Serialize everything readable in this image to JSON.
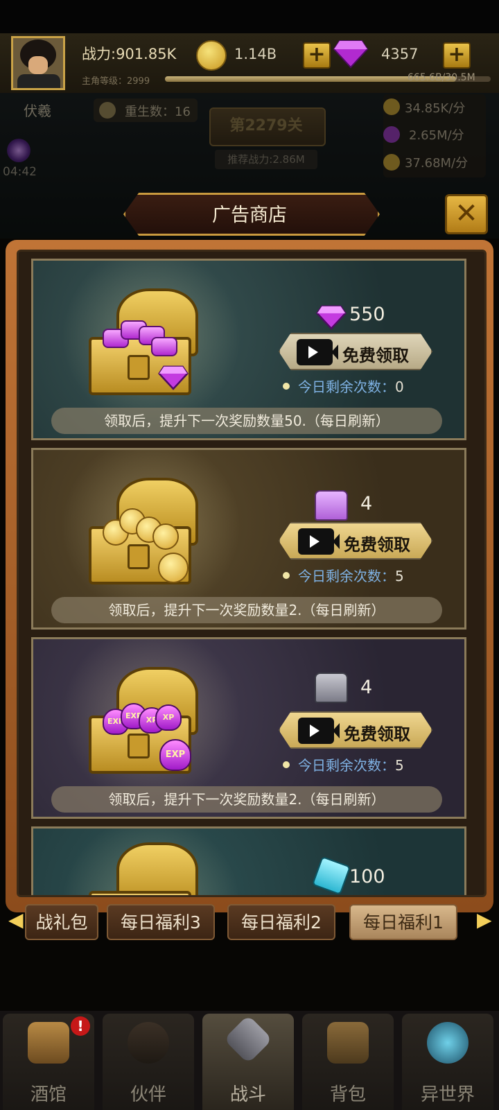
{
  "header": {
    "power": "战力:901.85K",
    "gold": "1.14B",
    "gems": "4357",
    "level_label": "主角等级：2999",
    "exp": "665.6B/30.5M",
    "level_progress": 0.9
  },
  "scene": {
    "hero_name": "伏羲",
    "rebirth": "重生数：16",
    "stage": "第2279关",
    "recommended_power": "推荐战力:2.86M",
    "timer": "04:42",
    "rates": [
      "34.85K/分",
      "2.65M/分",
      "37.68M/分"
    ]
  },
  "shop": {
    "title": "广告商店",
    "close_icon": "close-x-icon",
    "cards": [
      {
        "reward_icon": "gem-icon",
        "amount": "550",
        "button": "免费领取",
        "remaining_label": "今日剩余次数：",
        "remaining_value": "0",
        "note": "领取后，提升下一次奖励数量50.（每日刷新）",
        "bg": "#233637"
      },
      {
        "reward_icon": "gold-chest-icon",
        "amount": "4",
        "button": "免费领取",
        "remaining_label": "今日剩余次数：",
        "remaining_value": "5",
        "note": "领取后，提升下一次奖励数量2.（每日刷新）",
        "bg": "#3d311d"
      },
      {
        "reward_icon": "exp-chest-icon",
        "amount": "4",
        "button": "免费领取",
        "remaining_label": "今日剩余次数：",
        "remaining_value": "5",
        "note": "领取后，提升下一次奖励数量2.（每日刷新）",
        "bg": "#2d2836"
      },
      {
        "reward_icon": "crystal-icon",
        "amount": "100",
        "bg": "#1f3a3c"
      }
    ]
  },
  "tabs": [
    "战礼包",
    "每日福利3",
    "每日福利2",
    "每日福利1"
  ],
  "active_tab": 3,
  "nav": {
    "items": [
      "酒馆",
      "伙伴",
      "战斗",
      "背包",
      "异世界"
    ],
    "active": 2,
    "badge": "!"
  },
  "colors": {
    "accent_gold": "#e9c24a",
    "panel_frame": "#c07436",
    "gem_purple": "#b12ad0",
    "remain_blue": "#7fb2e4"
  }
}
